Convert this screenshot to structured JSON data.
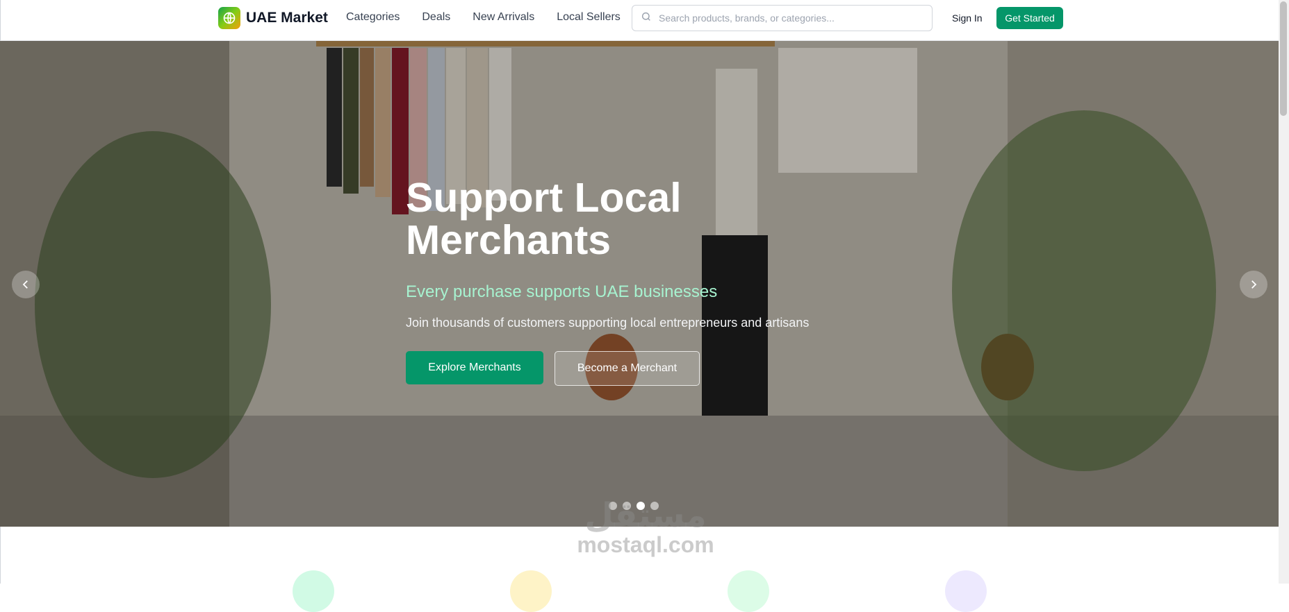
{
  "header": {
    "brand": "UAE Market",
    "nav": [
      "Categories",
      "Deals",
      "New Arrivals",
      "Local Sellers"
    ],
    "search_placeholder": "Search products, brands, or categories...",
    "sign_in": "Sign In",
    "get_started": "Get Started"
  },
  "hero": {
    "title": "Support Local Merchants",
    "subtitle": "Every purchase supports UAE businesses",
    "description": "Join thousands of customers supporting local entrepreneurs and artisans",
    "primary_button": "Explore Merchants",
    "secondary_button": "Become a Merchant",
    "slide_count": 4,
    "active_slide": 3
  },
  "watermark": {
    "arabic": "مستقل",
    "latin": "mostaql.com"
  },
  "colors": {
    "primary": "#059669",
    "subtitle": "#a7f3d0",
    "feature_icons": [
      "#d1fae5",
      "#fef3c7",
      "#dcfce7",
      "#ede9fe"
    ]
  },
  "icons": {
    "logo": "globe-icon",
    "search": "search-icon",
    "prev": "chevron-left-icon",
    "next": "chevron-right-icon"
  }
}
